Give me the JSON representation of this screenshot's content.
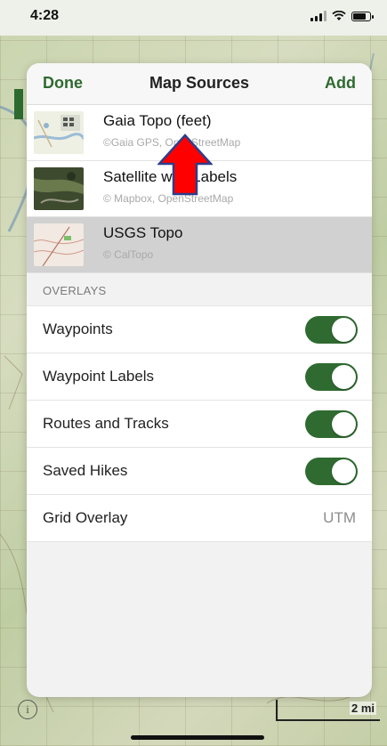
{
  "status": {
    "time": "4:28"
  },
  "sheet": {
    "done_label": "Done",
    "title": "Map Sources",
    "add_label": "Add"
  },
  "sources": [
    {
      "name": "Gaia Topo (feet)",
      "credit": "©Gaia GPS, OpenStreetMap",
      "selected": false
    },
    {
      "name": "Satellite with Labels",
      "credit": "© Mapbox, OpenStreetMap",
      "selected": false
    },
    {
      "name": "USGS Topo",
      "credit": "© CalTopo",
      "selected": true
    }
  ],
  "overlays": {
    "section_label": "OVERLAYS",
    "rows": [
      {
        "label": "Waypoints",
        "type": "toggle",
        "on": true
      },
      {
        "label": "Waypoint Labels",
        "type": "toggle",
        "on": true
      },
      {
        "label": "Routes and Tracks",
        "type": "toggle",
        "on": true
      },
      {
        "label": "Saved Hikes",
        "type": "toggle",
        "on": true
      },
      {
        "label": "Grid Overlay",
        "type": "value",
        "value": "UTM"
      }
    ]
  },
  "map": {
    "scale_label": "2 mi",
    "info_icon": "info-icon"
  },
  "colors": {
    "accent": "#2e6a2f",
    "toggle_on": "#2f6b30",
    "arrow": "#ff0000"
  }
}
